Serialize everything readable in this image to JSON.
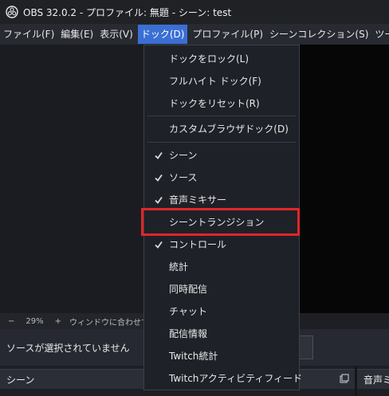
{
  "window": {
    "title": "OBS 32.0.2 - プロファイル: 無題 - シーン: test",
    "logo_icon": "obs-logo-icon"
  },
  "menubar": {
    "items": [
      {
        "label": "ファイル(F)"
      },
      {
        "label": "編集(E)"
      },
      {
        "label": "表示(V)"
      },
      {
        "label": "ドック(D)",
        "active": true
      },
      {
        "label": "プロファイル(P)"
      },
      {
        "label": "シーンコレクション(S)"
      },
      {
        "label": "ツール(T)"
      }
    ]
  },
  "dock_menu": {
    "items": [
      {
        "label": "ドックをロック(L)",
        "checked": false
      },
      {
        "label": "フルハイト ドック(F)",
        "checked": false
      },
      {
        "label": "ドックをリセット(R)",
        "checked": false
      },
      {
        "label": "カスタムブラウザドック(D)",
        "checked": false
      },
      {
        "label": "シーン",
        "checked": true
      },
      {
        "label": "ソース",
        "checked": true
      },
      {
        "label": "音声ミキサー",
        "checked": true
      },
      {
        "label": "シーントランジション",
        "checked": false,
        "highlighted": true
      },
      {
        "label": "コントロール",
        "checked": true
      },
      {
        "label": "統計",
        "checked": false
      },
      {
        "label": "同時配信",
        "checked": false
      },
      {
        "label": "チャット",
        "checked": false
      },
      {
        "label": "配信情報",
        "checked": false
      },
      {
        "label": "Twitch統計",
        "checked": false
      },
      {
        "label": "Twitchアクティビティフィード",
        "checked": false
      }
    ],
    "highlight_color": "#e0262a",
    "check_icon": "checkmark-icon"
  },
  "zoombar": {
    "minus": "−",
    "zoom": "29%",
    "plus": "+",
    "fit_label": "ウィンドウに合わせて"
  },
  "sources_bar": {
    "no_source_text": "ソースが選択されていません"
  },
  "docks": {
    "scene_title": "シーン",
    "audio_title": "音声ミキ",
    "float_icon": "undock-icon"
  },
  "colors": {
    "menu_active": "#3b6fd4",
    "background": "#1e1f24"
  }
}
